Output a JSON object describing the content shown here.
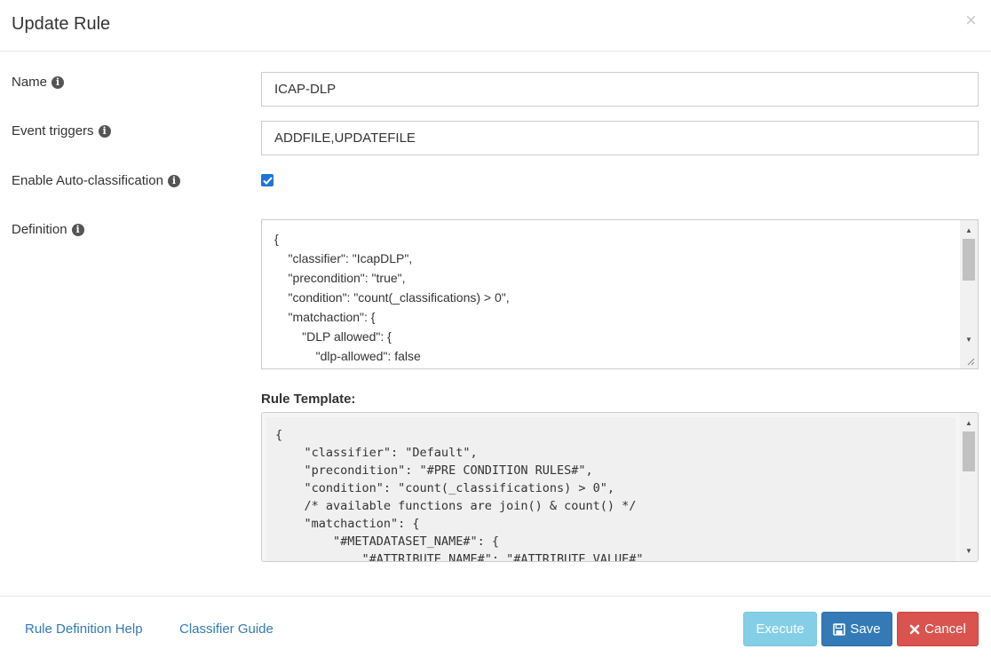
{
  "dialog": {
    "title": "Update Rule",
    "close_symbol": "×"
  },
  "form": {
    "name_label": "Name",
    "name_value": "ICAP-DLP",
    "triggers_label": "Event triggers",
    "triggers_value": "ADDFILE,UPDATEFILE",
    "autoclass_label": "Enable Auto-classification",
    "autoclass_checked": true,
    "definition_label": "Definition",
    "definition_text": "{\n    \"classifier\": \"IcapDLP\",\n    \"precondition\": \"true\",\n    \"condition\": \"count(_classifications) > 0\",\n    \"matchaction\": {\n        \"DLP allowed\": {\n            \"dlp-allowed\": false"
  },
  "template": {
    "label": "Rule Template:",
    "text": "{\n    \"classifier\": \"Default\",\n    \"precondition\": \"#PRE CONDITION RULES#\",\n    \"condition\": \"count(_classifications) > 0\",\n    /* available functions are join() & count() */\n    \"matchaction\": {\n        \"#METADATASET_NAME#\": {\n            \"#ATTRIBUTE_NAME#\": \"#ATTRIBUTE_VALUE#\""
  },
  "footer": {
    "help_link": "Rule Definition Help",
    "guide_link": "Classifier Guide",
    "execute_label": "Execute",
    "save_label": "Save",
    "cancel_label": "Cancel"
  },
  "icons": {
    "info": "info-circle-icon",
    "save": "floppy-disk-icon",
    "cancel": "x-mark-icon",
    "close": "close-icon"
  },
  "colors": {
    "primary": "#337ab7",
    "info": "#5bc0de",
    "danger": "#d9534f",
    "checkbox": "#1f75d6"
  }
}
